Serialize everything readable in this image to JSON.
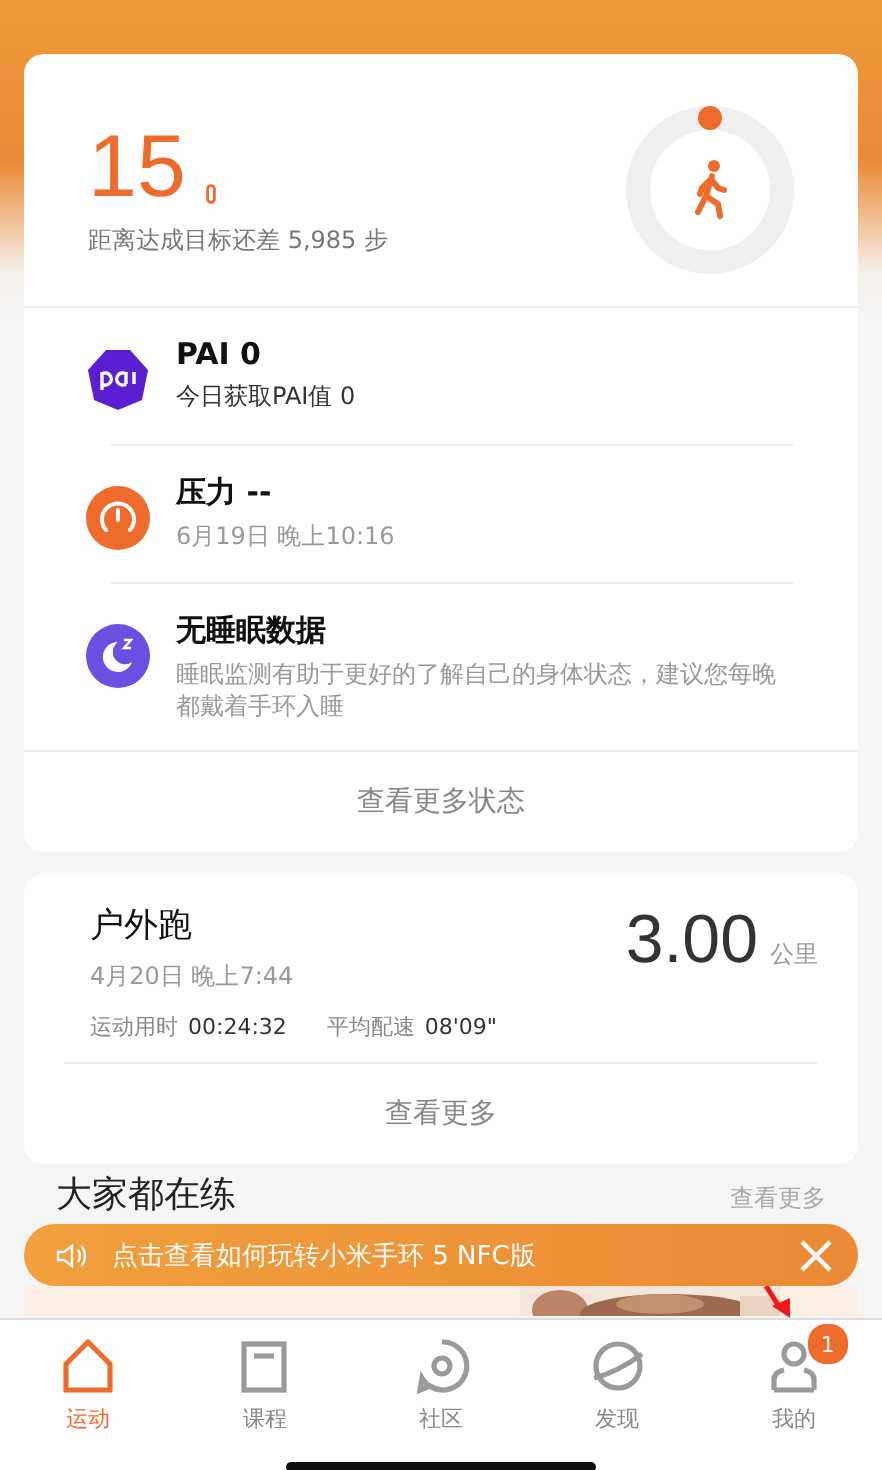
{
  "steps": {
    "value": "15",
    "goal": "距离达成目标还差 5,985 步"
  },
  "status_items": [
    {
      "kind": "pai",
      "title": "PAI 0",
      "subtitle": "今日获取PAI值 0"
    },
    {
      "kind": "stress",
      "title": "压力 --",
      "subtitle": "6月19日 晚上10:16"
    },
    {
      "kind": "sleep",
      "title": "无睡眠数据",
      "subtitle": "睡眠监测有助于更好的了解自己的身体状态，建议您每晚都戴着手环入睡"
    }
  ],
  "status_more": "查看更多状态",
  "workout": {
    "title": "户外跑",
    "date": "4月20日 晚上7:44",
    "distance": "3.00",
    "unit": "公里",
    "stats": [
      {
        "label": "运动用时",
        "value": "00:24:32"
      },
      {
        "label": "平均配速",
        "value": "08'09\""
      }
    ],
    "more": "查看更多"
  },
  "section": {
    "title": "大家都在练",
    "more": "查看更多"
  },
  "banner": {
    "text": "点击查看如何玩转小米手环 5 NFC版"
  },
  "tabs": [
    {
      "label": "运动",
      "selected": true
    },
    {
      "label": "课程",
      "selected": false
    },
    {
      "label": "社区",
      "selected": false
    },
    {
      "label": "发现",
      "selected": false
    },
    {
      "label": "我的",
      "selected": false,
      "badge": "1"
    }
  ]
}
